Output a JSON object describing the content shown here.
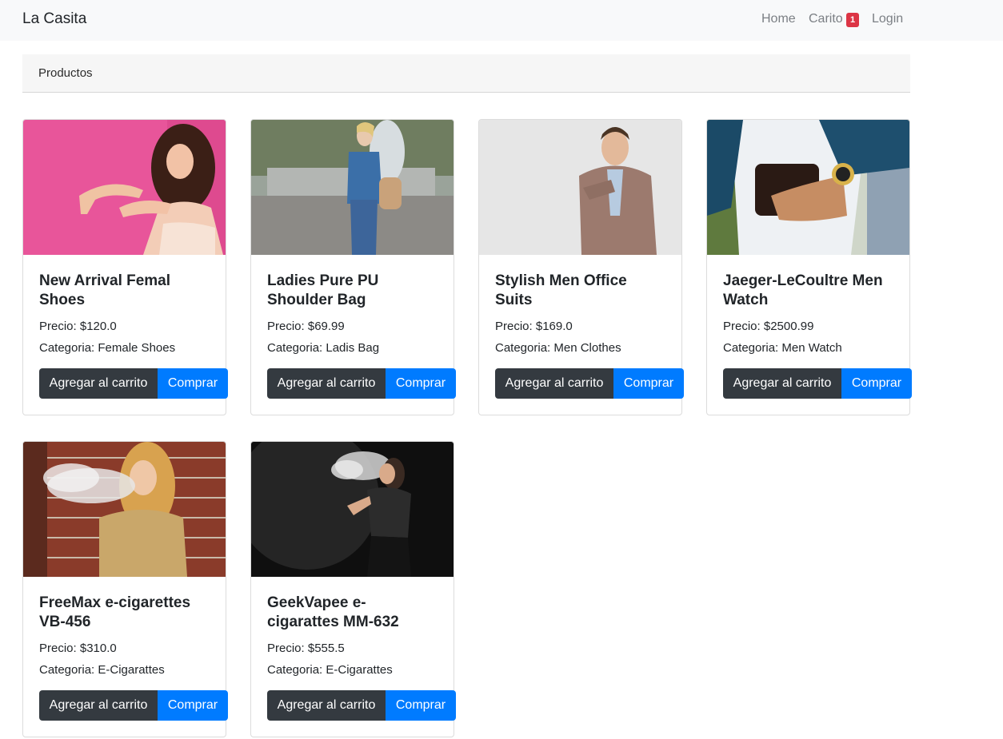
{
  "navbar": {
    "brand": "La Casita",
    "links": {
      "home": "Home",
      "cart": "Carito",
      "login": "Login"
    },
    "cart_count": "1"
  },
  "breadcrumb": {
    "label": "Productos"
  },
  "colors": {
    "primary": "#007bff",
    "dark": "#343a40",
    "badge": "#dc3545"
  },
  "products": [
    {
      "title": "New Arrival Femal Shoes",
      "price": "Precio: $120.0",
      "category": "Categoria: Female Shoes",
      "add_label": "Agregar al carrito",
      "buy_label": "Comprar"
    },
    {
      "title": "Ladies Pure PU Shoulder Bag",
      "price": "Precio: $69.99",
      "category": "Categoria: Ladis Bag",
      "add_label": "Agregar al carrito",
      "buy_label": "Comprar"
    },
    {
      "title": "Stylish Men Office Suits",
      "price": "Precio: $169.0",
      "category": "Categoria: Men Clothes",
      "add_label": "Agregar al carrito",
      "buy_label": "Comprar"
    },
    {
      "title": "Jaeger-LeCoultre Men Watch",
      "price": "Precio: $2500.99",
      "category": "Categoria: Men Watch",
      "add_label": "Agregar al carrito",
      "buy_label": "Comprar"
    },
    {
      "title": "FreeMax e-cigarettes VB-456",
      "price": "Precio: $310.0",
      "category": "Categoria: E-Cigarattes",
      "add_label": "Agregar al carrito",
      "buy_label": "Comprar"
    },
    {
      "title": "GeekVapee e-cigarattes MM-632",
      "price": "Precio: $555.5",
      "category": "Categoria: E-Cigarattes",
      "add_label": "Agregar al carrito",
      "buy_label": "Comprar"
    }
  ]
}
